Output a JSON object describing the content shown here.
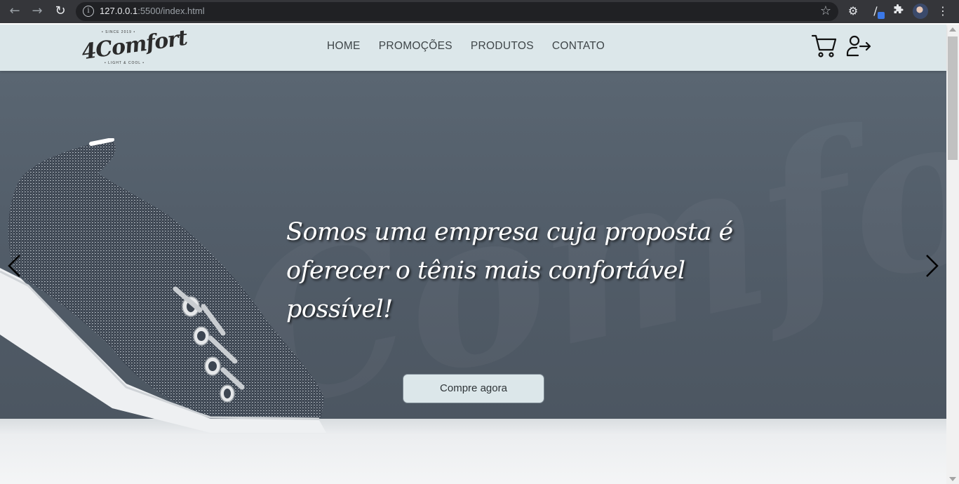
{
  "browser": {
    "url_host": "127.0.0.1",
    "url_rest": ":5500/index.html"
  },
  "header": {
    "logo": {
      "brand": "4Comfort",
      "since": "• SINCE 2019 •",
      "tagline": "• LIGHT & COOL •"
    },
    "menu": [
      {
        "label": "HOME"
      },
      {
        "label": "PROMOÇÕES"
      },
      {
        "label": "PRODUTOS"
      },
      {
        "label": "CONTATO"
      }
    ],
    "icons": {
      "cart": "cart-icon",
      "login": "login-icon"
    }
  },
  "hero": {
    "headline": "Somos uma empresa cuja proposta é oferecer o tênis mais confortável possível!",
    "cta_label": "Compre agora",
    "watermark": "Comfort",
    "prev_icon": "chevron-left-icon",
    "next_icon": "chevron-right-icon"
  },
  "colors": {
    "header_bg": "#dce7ea",
    "hero_bg": "#56616d",
    "cta_bg": "#dce7ea",
    "menu_text": "#3e4548"
  }
}
